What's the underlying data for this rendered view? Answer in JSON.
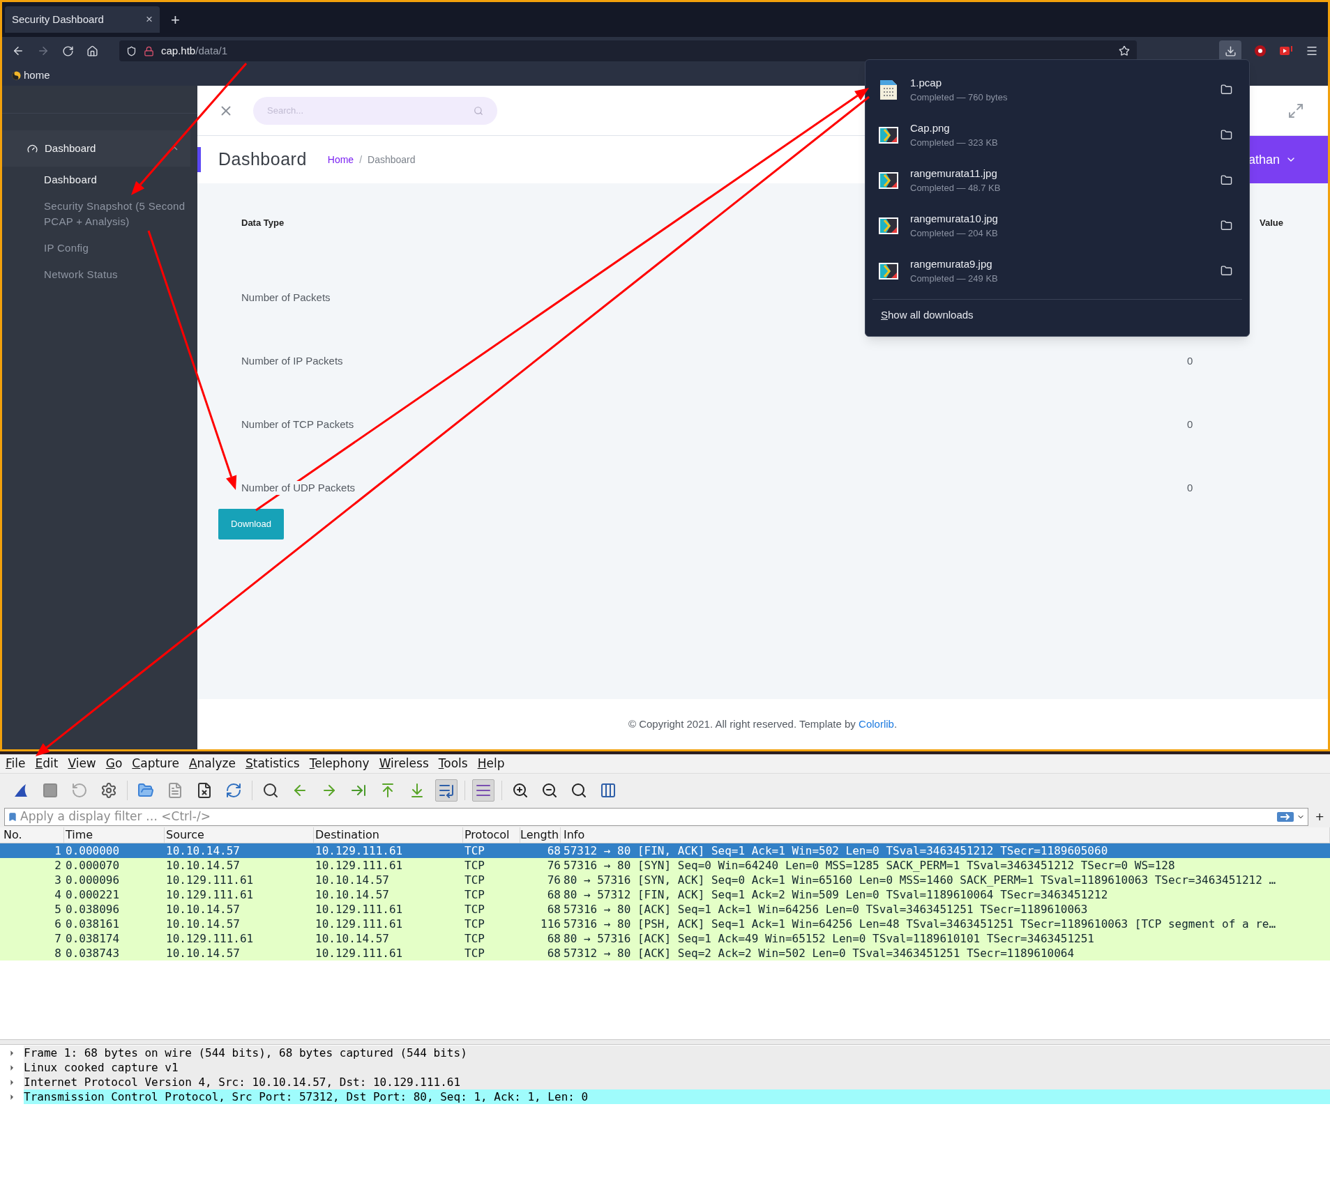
{
  "browser": {
    "tab": {
      "title": "Security Dashboard",
      "close": "×"
    },
    "new_tab": "+",
    "forward_disabled": true,
    "url": {
      "host": "cap.htb",
      "path": "/data/1"
    },
    "downloads_active": true,
    "bookmark": "home"
  },
  "sidebar": {
    "groups": [
      {
        "label": "Dashboard",
        "expanded": true,
        "children": [
          {
            "label": "Dashboard",
            "selected": true
          },
          {
            "label": "Security Snapshot (5 Second PCAP + Analysis)",
            "selected": false
          },
          {
            "label": "IP Config",
            "selected": false
          },
          {
            "label": "Network Status",
            "selected": false
          }
        ]
      }
    ]
  },
  "search": {
    "placeholder": "Search..."
  },
  "page": {
    "title": "Dashboard",
    "breadcrumb": [
      "Home",
      "Dashboard"
    ],
    "breadcrumb_separator": "/",
    "user": "athan",
    "table": {
      "columns": [
        "Data Type",
        "Value"
      ],
      "rows": [
        {
          "label": "Number of Packets"
        },
        {
          "label": "Number of IP Packets",
          "value": "0"
        },
        {
          "label": "Number of TCP Packets",
          "value": "0"
        },
        {
          "label": "Number of UDP Packets",
          "value": "0"
        }
      ]
    },
    "button": "Download",
    "footer": {
      "text": "© Copyright 2021. All right reserved. Template by",
      "link": "Colorlib",
      "end": "."
    }
  },
  "downloads": {
    "items": [
      {
        "kind": "pcap",
        "name": "1.pcap",
        "status": "Completed — 760 bytes"
      },
      {
        "kind": "image",
        "name": "Cap.png",
        "status": "Completed — 323 KB"
      },
      {
        "kind": "image",
        "name": "rangemurata11.jpg",
        "status": "Completed — 48.7 KB"
      },
      {
        "kind": "image",
        "name": "rangemurata10.jpg",
        "status": "Completed — 204 KB"
      },
      {
        "kind": "image",
        "name": "rangemurata9.jpg",
        "status": "Completed — 249 KB"
      }
    ],
    "show_all": "Show all downloads"
  },
  "wireshark": {
    "menu": [
      "File",
      "Edit",
      "View",
      "Go",
      "Capture",
      "Analyze",
      "Statistics",
      "Telephony",
      "Wireless",
      "Tools",
      "Help"
    ],
    "toolbar": [
      {
        "pressed": false
      },
      {
        "pressed": false
      },
      {
        "pressed": false
      },
      {
        "pressed": false
      },
      {
        "pressed": false
      },
      {
        "pressed": false
      },
      {
        "pressed": false
      },
      {
        "pressed": false
      },
      {
        "pressed": false
      },
      {
        "pressed": false
      },
      {
        "pressed": false
      },
      {
        "pressed": false
      },
      {
        "pressed": false
      },
      {
        "pressed": false
      },
      {
        "pressed": true
      },
      {
        "pressed": true
      },
      {
        "pressed": false
      },
      {
        "pressed": false
      },
      {
        "pressed": false
      },
      {
        "pressed": false
      }
    ],
    "filter": {
      "placeholder": "Apply a display filter … <Ctrl-/>",
      "plus": "+"
    },
    "packets": {
      "columns": [
        "No.",
        "Time",
        "Source",
        "Destination",
        "Protocol",
        "Length",
        "Info"
      ],
      "rows": [
        {
          "no": "1",
          "time": "0.000000",
          "source": "10.10.14.57",
          "destination": "10.129.111.61",
          "protocol": "TCP",
          "length": "68",
          "info": "57312 → 80 [FIN, ACK] Seq=1 Ack=1 Win=502 Len=0 TSval=3463451212 TSecr=1189605060",
          "selected": true
        },
        {
          "no": "2",
          "time": "0.000070",
          "source": "10.10.14.57",
          "destination": "10.129.111.61",
          "protocol": "TCP",
          "length": "76",
          "info": "57316 → 80 [SYN] Seq=0 Win=64240 Len=0 MSS=1285 SACK_PERM=1 TSval=3463451212 TSecr=0 WS=128",
          "selected": false
        },
        {
          "no": "3",
          "time": "0.000096",
          "source": "10.129.111.61",
          "destination": "10.10.14.57",
          "protocol": "TCP",
          "length": "76",
          "info": "80 → 57316 [SYN, ACK] Seq=0 Ack=1 Win=65160 Len=0 MSS=1460 SACK_PERM=1 TSval=1189610063 TSecr=3463451212 …",
          "selected": false
        },
        {
          "no": "4",
          "time": "0.000221",
          "source": "10.129.111.61",
          "destination": "10.10.14.57",
          "protocol": "TCP",
          "length": "68",
          "info": "80 → 57312 [FIN, ACK] Seq=1 Ack=2 Win=509 Len=0 TSval=1189610064 TSecr=3463451212",
          "selected": false
        },
        {
          "no": "5",
          "time": "0.038096",
          "source": "10.10.14.57",
          "destination": "10.129.111.61",
          "protocol": "TCP",
          "length": "68",
          "info": "57316 → 80 [ACK] Seq=1 Ack=1 Win=64256 Len=0 TSval=3463451251 TSecr=1189610063",
          "selected": false
        },
        {
          "no": "6",
          "time": "0.038161",
          "source": "10.10.14.57",
          "destination": "10.129.111.61",
          "protocol": "TCP",
          "length": "116",
          "info": "57316 → 80 [PSH, ACK] Seq=1 Ack=1 Win=64256 Len=48 TSval=3463451251 TSecr=1189610063 [TCP segment of a re…",
          "selected": false
        },
        {
          "no": "7",
          "time": "0.038174",
          "source": "10.129.111.61",
          "destination": "10.10.14.57",
          "protocol": "TCP",
          "length": "68",
          "info": "80 → 57316 [ACK] Seq=1 Ack=49 Win=65152 Len=0 TSval=1189610101 TSecr=3463451251",
          "selected": false
        },
        {
          "no": "8",
          "time": "0.038743",
          "source": "10.10.14.57",
          "destination": "10.129.111.61",
          "protocol": "TCP",
          "length": "68",
          "info": "57312 → 80 [ACK] Seq=2 Ack=2 Win=502 Len=0 TSval=3463451251 TSecr=1189610064",
          "selected": false
        }
      ]
    },
    "details": [
      {
        "text": "Frame 1: 68 bytes on wire (544 bits), 68 bytes captured (544 bits)",
        "expanded": false,
        "selected": false
      },
      {
        "text": "Linux cooked capture v1",
        "expanded": false,
        "selected": false
      },
      {
        "text": "Internet Protocol Version 4, Src: 10.10.14.57, Dst: 10.129.111.61",
        "expanded": false,
        "selected": false
      },
      {
        "text": "Transmission Control Protocol, Src Port: 57312, Dst Port: 80, Seq: 1, Ack: 1, Len: 0",
        "expanded": false,
        "selected": true
      }
    ]
  }
}
